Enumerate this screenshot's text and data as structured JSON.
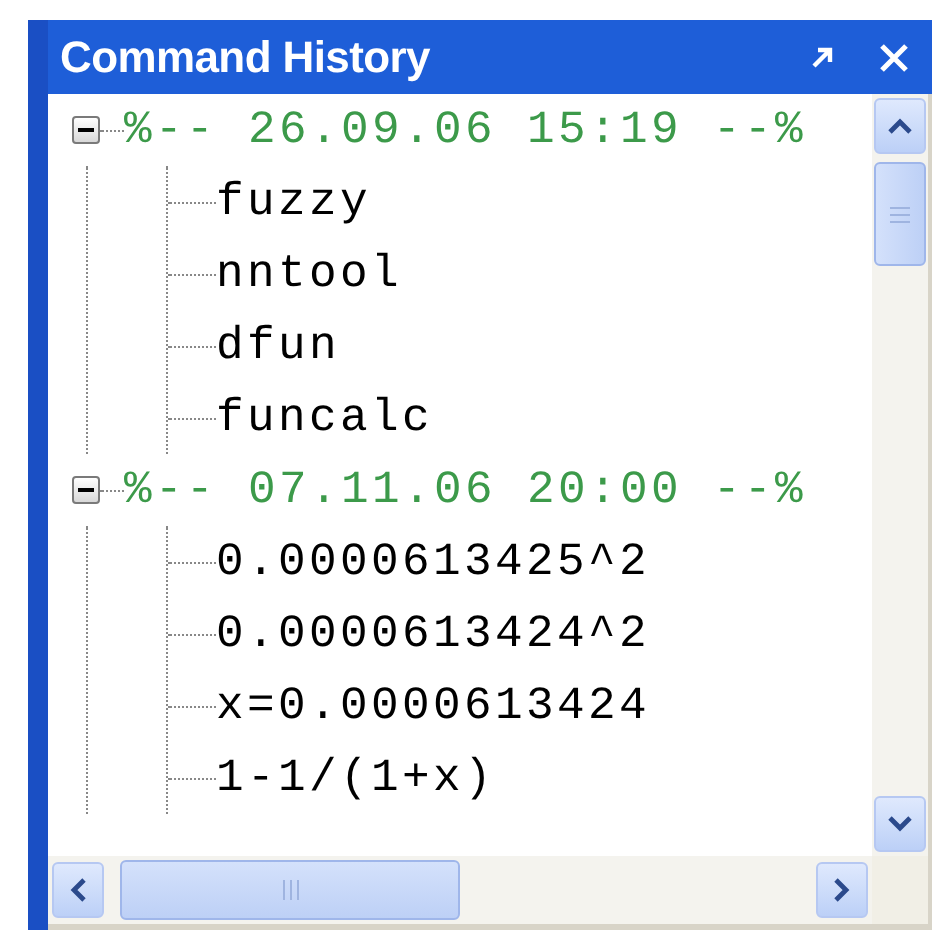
{
  "window": {
    "title": "Command History"
  },
  "sessions": [
    {
      "header": "%-- 26.09.06 15:19 --%",
      "expanded": true,
      "commands": [
        "fuzzy",
        "nntool",
        "dfun",
        "funcalc"
      ]
    },
    {
      "header": "%-- 07.11.06 20:00 --%",
      "expanded": true,
      "commands": [
        "0.0000613425^2",
        "0.0000613424^2",
        "x=0.0000613424",
        "1-1/(1+x)"
      ]
    }
  ]
}
